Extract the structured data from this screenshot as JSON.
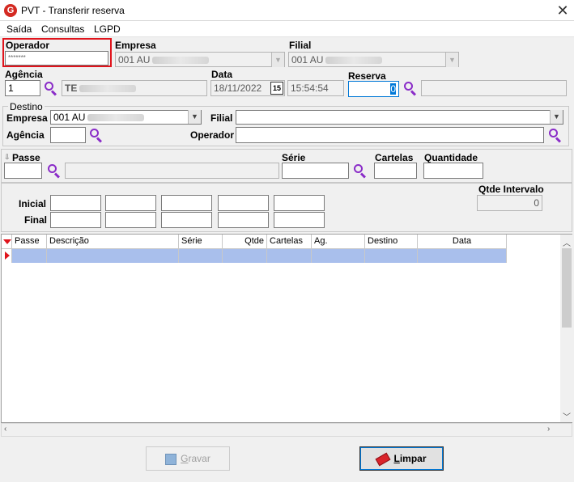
{
  "window": {
    "title": "PVT - Transferir reserva",
    "logo_letter": "G",
    "close_glyph": "✕"
  },
  "menu": [
    "Saída",
    "Consultas",
    "LGPD"
  ],
  "top": {
    "operador_label": "Operador",
    "operador_value": "*******",
    "empresa_label": "Empresa",
    "empresa_value": "001 AU",
    "filial_label": "Filial",
    "filial_value": "001 AU",
    "agencia_label": "Agência",
    "agencia_value": "1",
    "agencia_name": "TE",
    "data_label": "Data",
    "data_value": "18/11/2022",
    "calendar_day": "15",
    "time_value": "15:54:54",
    "reserva_label": "Reserva",
    "reserva_value": "0"
  },
  "destino": {
    "group_label": "Destino",
    "empresa_label": "Empresa",
    "empresa_value": "001 AU",
    "filial_label": "Filial",
    "agencia_label": "Agência",
    "operador_label": "Operador"
  },
  "passe": {
    "passe_label": "Passe",
    "serie_label": "Série",
    "cartelas_label": "Cartelas",
    "quantidade_label": "Quantidade"
  },
  "intervalo": {
    "inicial_label": "Inicial",
    "final_label": "Final",
    "qtde_label": "Qtde Intervalo",
    "qtde_value": "0"
  },
  "grid": {
    "columns": [
      "Passe",
      "Descrição",
      "Série",
      "Qtde",
      "Cartelas",
      "Ag.",
      "Destino",
      "Data"
    ]
  },
  "buttons": {
    "gravar_rest": "ravar",
    "gravar_first": "G",
    "limpar_first": "L",
    "limpar_rest": "impar"
  },
  "colors": {
    "accent_purple": "#8a2cc8",
    "highlight_red": "#e0141c",
    "row_selected": "#a9bfec",
    "logo_red": "#d42a22"
  }
}
